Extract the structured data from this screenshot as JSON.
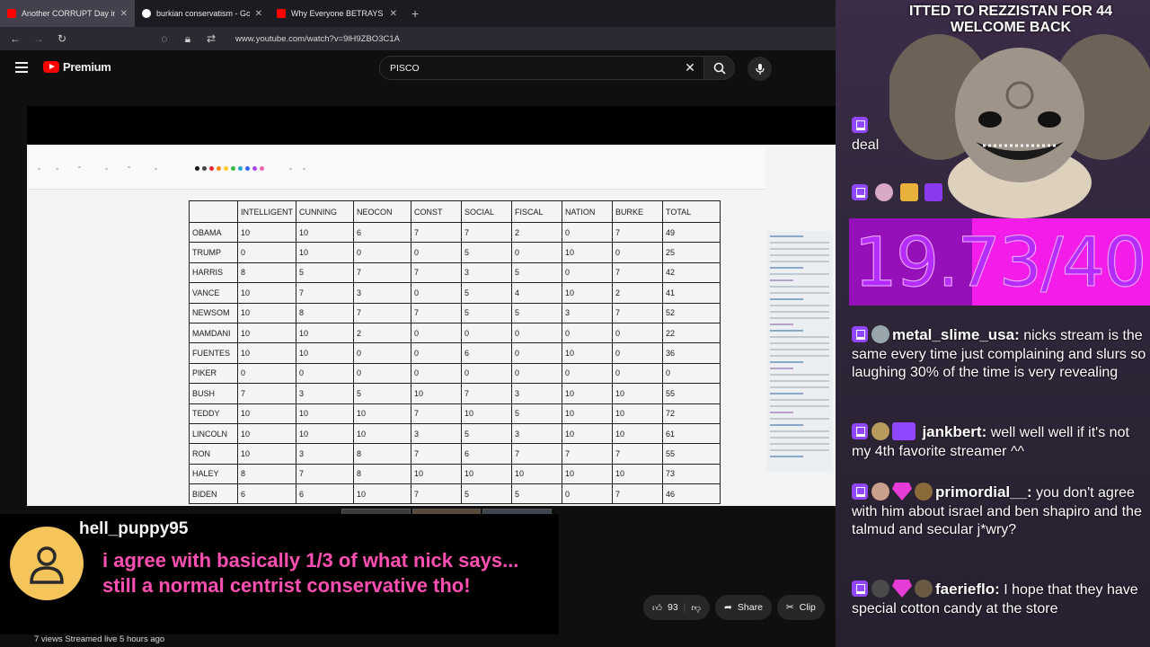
{
  "browser": {
    "tabs": [
      {
        "title": "Another CORRUPT Day in Amer",
        "favicon": "youtube-icon",
        "active": true
      },
      {
        "title": "burkian conservatism - Google",
        "favicon": "google-icon",
        "active": false
      },
      {
        "title": "Why Everyone BETRAYS Destiny",
        "favicon": "youtube-icon",
        "active": false
      }
    ],
    "url": "www.youtube.com/watch?v=9lH9ZBO3C1A"
  },
  "youtube": {
    "brand": "Premium",
    "search_value": "PISCO"
  },
  "whiteboard_table": {
    "headers": [
      "",
      "INTELLIGENT",
      "CUNNING",
      "NEOCON",
      "CONST",
      "SOCIAL",
      "FISCAL",
      "NATION",
      "BURKE",
      "TOTAL"
    ],
    "rows": [
      [
        "OBAMA",
        "10",
        "10",
        "6",
        "7",
        "7",
        "2",
        "0",
        "7",
        "49"
      ],
      [
        "TRUMP",
        "0",
        "10",
        "0",
        "0",
        "5",
        "0",
        "10",
        "0",
        "25"
      ],
      [
        "HARRIS",
        "8",
        "5",
        "7",
        "7",
        "3",
        "5",
        "0",
        "7",
        "42"
      ],
      [
        "VANCE",
        "10",
        "7",
        "3",
        "0",
        "5",
        "4",
        "10",
        "2",
        "41"
      ],
      [
        "NEWSOM",
        "10",
        "8",
        "7",
        "7",
        "5",
        "5",
        "3",
        "7",
        "52"
      ],
      [
        "MAMDANI",
        "10",
        "10",
        "2",
        "0",
        "0",
        "0",
        "0",
        "0",
        "22"
      ],
      [
        "FUENTES",
        "10",
        "10",
        "0",
        "0",
        "6",
        "0",
        "10",
        "0",
        "36"
      ],
      [
        "PIKER",
        "0",
        "0",
        "0",
        "0",
        "0",
        "0",
        "0",
        "0",
        "0"
      ],
      [
        "BUSH",
        "7",
        "3",
        "5",
        "10",
        "7",
        "3",
        "10",
        "10",
        "55"
      ],
      [
        "TEDDY",
        "10",
        "10",
        "10",
        "7",
        "10",
        "5",
        "10",
        "10",
        "72"
      ],
      [
        "LINCOLN",
        "10",
        "10",
        "10",
        "3",
        "5",
        "3",
        "10",
        "10",
        "61"
      ],
      [
        "RON",
        "10",
        "3",
        "8",
        "7",
        "6",
        "7",
        "7",
        "7",
        "55"
      ],
      [
        "HALEY",
        "8",
        "7",
        "8",
        "10",
        "10",
        "10",
        "10",
        "10",
        "73"
      ],
      [
        "BIDEN",
        "6",
        "6",
        "10",
        "7",
        "5",
        "5",
        "0",
        "7",
        "46"
      ]
    ]
  },
  "video_actions": {
    "likes": "93",
    "share": "Share",
    "clip": "Clip",
    "views": "7 views  Streamed live 5 hours ago"
  },
  "overlay_chat": {
    "username": "hell_puppy95",
    "message": "i agree with basically 1/3 of what nick says... still a normal centrist conservative tho!"
  },
  "stream_panel": {
    "alert_line1": "ITTED TO REZZISTAN FOR 44",
    "alert_line2": "WELCOME BACK",
    "first_msg": "deal",
    "score_left": "19.7",
    "score_right": "3/40",
    "messages": [
      {
        "user": "metal_slime_usa:",
        "text": " nicks stream is the same every time just complaining and slurs so laughing 30% of the time is very revealing"
      },
      {
        "user": "jankbert:",
        "text": " well well well if it's not my 4th favorite streamer ^^"
      },
      {
        "user": "primordial__:",
        "text": " you don't agree with him about israel and ben shapiro and the talmud and secular j*wry?"
      },
      {
        "user": "faerieflo:",
        "text": " I hope that they have special cotton candy at the store"
      }
    ]
  }
}
